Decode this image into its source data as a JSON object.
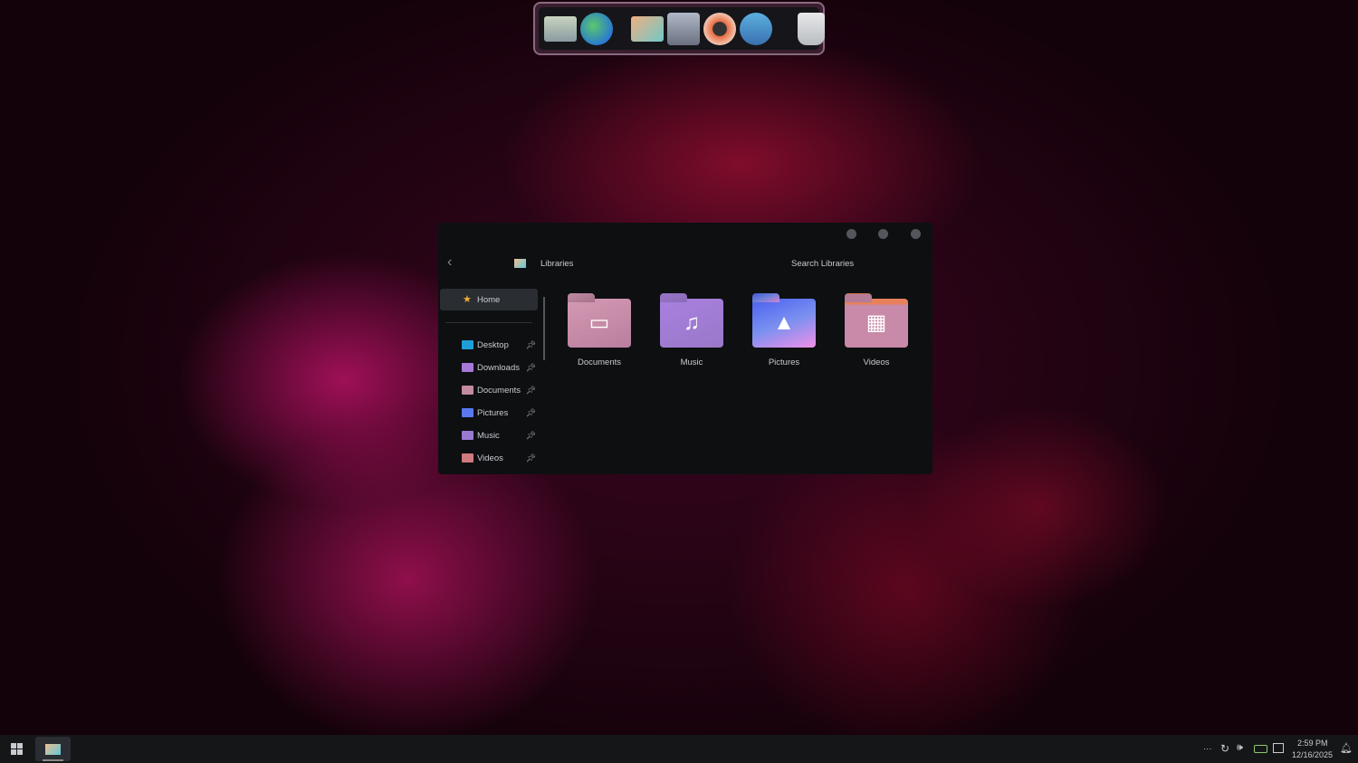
{
  "dock": {
    "items": [
      "desktop-app",
      "globe-browser",
      "home-folder",
      "disk-utility",
      "firewall-shield",
      "settings-sliders",
      "recycle-bin"
    ]
  },
  "window": {
    "location": "Libraries",
    "search_placeholder": "Search Libraries",
    "sidebar": {
      "home": "Home",
      "items": [
        {
          "label": "Desktop",
          "color": "#1e9fd8"
        },
        {
          "label": "Downloads",
          "color": "#a878d8"
        },
        {
          "label": "Documents",
          "color": "#c48aa0"
        },
        {
          "label": "Pictures",
          "color": "#5a78f0"
        },
        {
          "label": "Music",
          "color": "#9a7ad0"
        },
        {
          "label": "Videos",
          "color": "#d07a80"
        }
      ]
    },
    "libraries": [
      {
        "label": "Documents",
        "glyph": "▭"
      },
      {
        "label": "Music",
        "glyph": "♫"
      },
      {
        "label": "Pictures",
        "glyph": "▲"
      },
      {
        "label": "Videos",
        "glyph": "▦"
      }
    ]
  },
  "taskbar": {
    "time": "2:59 PM",
    "date": "12/16/2025",
    "overflow": "···"
  }
}
